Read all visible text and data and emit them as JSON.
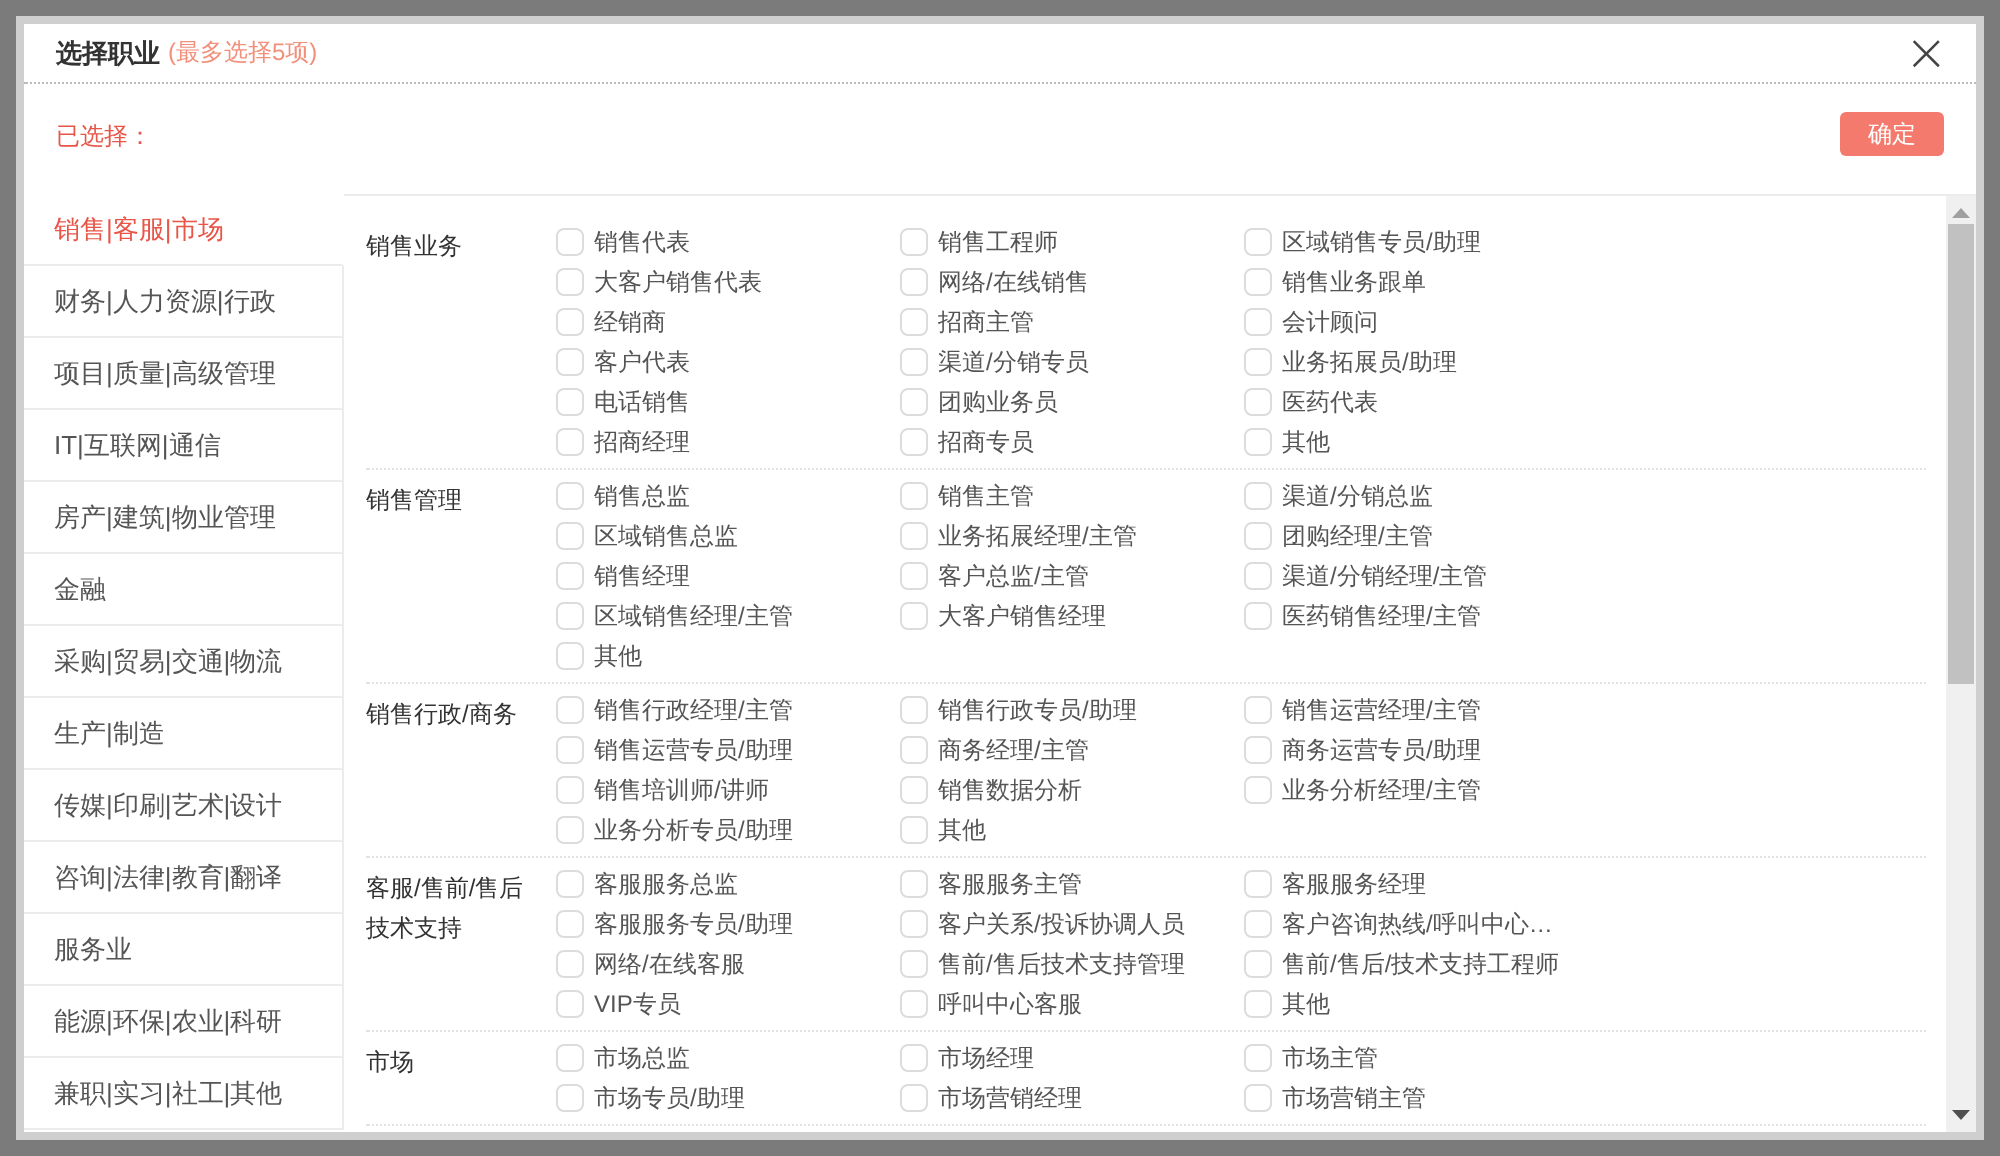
{
  "dialog": {
    "title": "选择职业",
    "hint": "(最多选择5项)",
    "selected_label": "已选择：",
    "confirm_button": "确定",
    "close_icon": "×"
  },
  "sidebar": {
    "items": [
      {
        "label": "销售|客服|市场",
        "selected": true
      },
      {
        "label": "财务|人力资源|行政",
        "selected": false
      },
      {
        "label": "项目|质量|高级管理",
        "selected": false
      },
      {
        "label": "IT|互联网|通信",
        "selected": false
      },
      {
        "label": "房产|建筑|物业管理",
        "selected": false
      },
      {
        "label": "金融",
        "selected": false
      },
      {
        "label": "采购|贸易|交通|物流",
        "selected": false
      },
      {
        "label": "生产|制造",
        "selected": false
      },
      {
        "label": "传媒|印刷|艺术|设计",
        "selected": false
      },
      {
        "label": "咨询|法律|教育|翻译",
        "selected": false
      },
      {
        "label": "服务业",
        "selected": false
      },
      {
        "label": "能源|环保|农业|科研",
        "selected": false
      },
      {
        "label": "兼职|实习|社工|其他",
        "selected": false
      }
    ]
  },
  "groups": [
    {
      "title": "销售业务",
      "options": [
        {
          "label": "销售代表",
          "checked": false
        },
        {
          "label": "销售工程师",
          "checked": false
        },
        {
          "label": "区域销售专员/助理",
          "checked": false
        },
        {
          "label": "大客户销售代表",
          "checked": false
        },
        {
          "label": "网络/在线销售",
          "checked": false
        },
        {
          "label": "销售业务跟单",
          "checked": false
        },
        {
          "label": "经销商",
          "checked": false
        },
        {
          "label": "招商主管",
          "checked": false
        },
        {
          "label": "会计顾问",
          "checked": false
        },
        {
          "label": "客户代表",
          "checked": false
        },
        {
          "label": "渠道/分销专员",
          "checked": false
        },
        {
          "label": "业务拓展员/助理",
          "checked": false
        },
        {
          "label": "电话销售",
          "checked": false
        },
        {
          "label": "团购业务员",
          "checked": false
        },
        {
          "label": "医药代表",
          "checked": false
        },
        {
          "label": "招商经理",
          "checked": false
        },
        {
          "label": "招商专员",
          "checked": false
        },
        {
          "label": "其他",
          "checked": false
        }
      ]
    },
    {
      "title": "销售管理",
      "options": [
        {
          "label": "销售总监",
          "checked": false
        },
        {
          "label": "销售主管",
          "checked": false
        },
        {
          "label": "渠道/分销总监",
          "checked": false
        },
        {
          "label": "区域销售总监",
          "checked": false
        },
        {
          "label": "业务拓展经理/主管",
          "checked": false
        },
        {
          "label": "团购经理/主管",
          "checked": false
        },
        {
          "label": "销售经理",
          "checked": false
        },
        {
          "label": "客户总监/主管",
          "checked": false
        },
        {
          "label": "渠道/分销经理/主管",
          "checked": false
        },
        {
          "label": "区域销售经理/主管",
          "checked": false
        },
        {
          "label": "大客户销售经理",
          "checked": false
        },
        {
          "label": "医药销售经理/主管",
          "checked": false
        },
        {
          "label": "其他",
          "checked": false
        }
      ]
    },
    {
      "title": "销售行政/商务",
      "options": [
        {
          "label": "销售行政经理/主管",
          "checked": false
        },
        {
          "label": "销售行政专员/助理",
          "checked": false
        },
        {
          "label": "销售运营经理/主管",
          "checked": false
        },
        {
          "label": "销售运营专员/助理",
          "checked": false
        },
        {
          "label": "商务经理/主管",
          "checked": false
        },
        {
          "label": "商务运营专员/助理",
          "checked": false
        },
        {
          "label": "销售培训师/讲师",
          "checked": false
        },
        {
          "label": "销售数据分析",
          "checked": false
        },
        {
          "label": "业务分析经理/主管",
          "checked": false
        },
        {
          "label": "业务分析专员/助理",
          "checked": false
        },
        {
          "label": "其他",
          "checked": false
        }
      ]
    },
    {
      "title": "客服/售前/售后技术支持",
      "options": [
        {
          "label": "客服服务总监",
          "checked": false
        },
        {
          "label": "客服服务主管",
          "checked": false
        },
        {
          "label": "客服服务经理",
          "checked": false
        },
        {
          "label": "客服服务专员/助理",
          "checked": false
        },
        {
          "label": "客户关系/投诉协调人员",
          "checked": false
        },
        {
          "label": "客户咨询热线/呼叫中心…",
          "checked": false
        },
        {
          "label": "网络/在线客服",
          "checked": false
        },
        {
          "label": "售前/售后技术支持管理",
          "checked": false
        },
        {
          "label": "售前/售后/技术支持工程师",
          "checked": false
        },
        {
          "label": "VIP专员",
          "checked": false
        },
        {
          "label": "呼叫中心客服",
          "checked": false
        },
        {
          "label": "其他",
          "checked": false
        }
      ]
    },
    {
      "title": "市场",
      "options": [
        {
          "label": "市场总监",
          "checked": false
        },
        {
          "label": "市场经理",
          "checked": false
        },
        {
          "label": "市场主管",
          "checked": false
        },
        {
          "label": "市场专员/助理",
          "checked": false
        },
        {
          "label": "市场营销经理",
          "checked": false
        },
        {
          "label": "市场营销主管",
          "checked": false
        }
      ]
    }
  ]
}
